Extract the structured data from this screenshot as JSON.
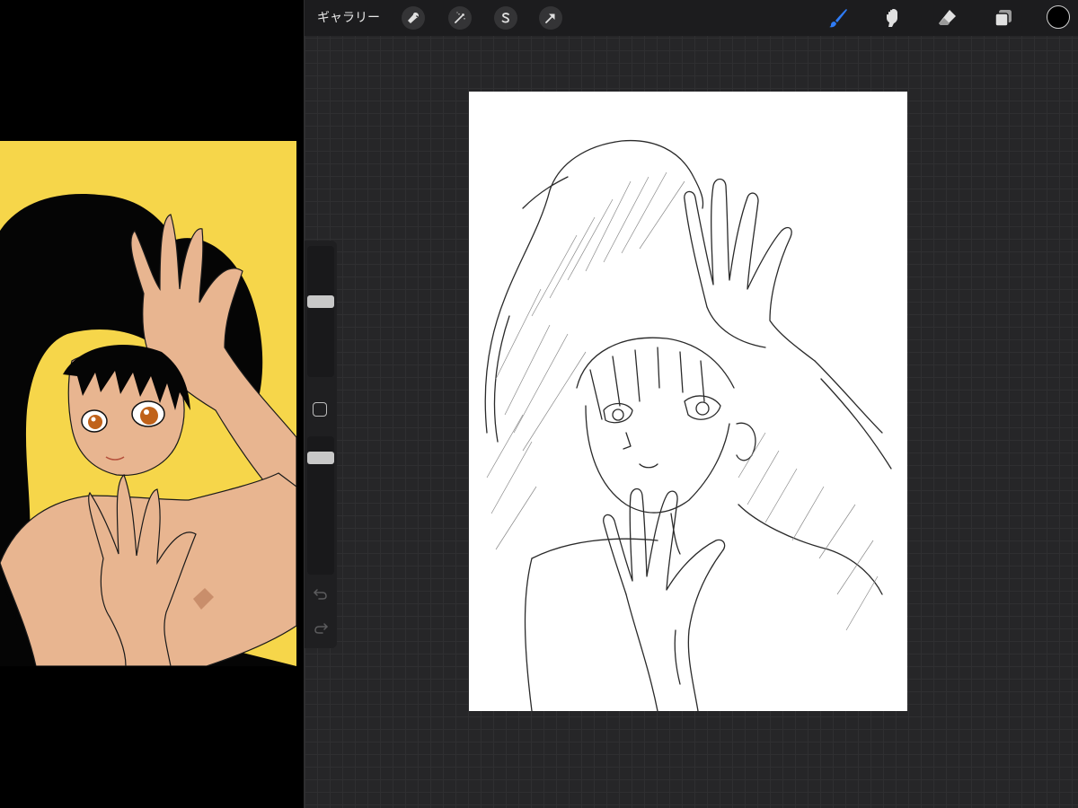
{
  "screen": {
    "left_app": {
      "name": "reference-artwork",
      "colors": {
        "background": "#000000",
        "yellow": "#f6d64a",
        "skin": "#e8b590",
        "hair": "#050505",
        "eyes": "#c0621a"
      }
    },
    "procreate": {
      "top_bar": {
        "gallery_label": "ギャラリー",
        "actions_icon": "wrench-icon",
        "adjustments_icon": "magic-wand-icon",
        "selection_icon": "selection-s-icon",
        "transform_icon": "arrow-cursor-icon",
        "brush_icon": "brush-icon",
        "smudge_icon": "smudge-finger-icon",
        "eraser_icon": "eraser-icon",
        "layers_icon": "layers-icon",
        "active_tool": "brush",
        "accent_color": "#2f7cf6",
        "current_color": "#000000"
      },
      "sidebar": {
        "brush_size": 0.58,
        "brush_opacity": 0.88,
        "modifier_icon": "square-modifier-icon",
        "undo_icon": "undo-icon",
        "redo_icon": "redo-icon"
      },
      "canvas": {
        "background": "#ffffff",
        "content": "pencil-sketch"
      }
    }
  }
}
